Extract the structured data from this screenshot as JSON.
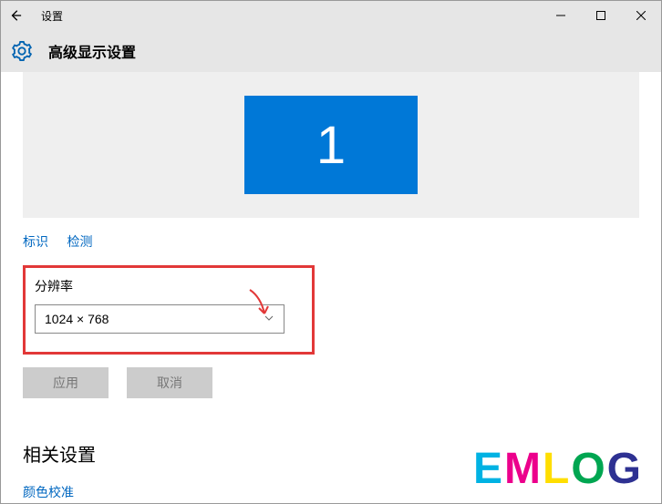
{
  "titlebar": {
    "title": "设置"
  },
  "header": {
    "heading": "高级显示设置"
  },
  "monitor": {
    "number": "1"
  },
  "links": {
    "identify": "标识",
    "detect": "检测"
  },
  "resolution": {
    "label": "分辨率",
    "value": "1024 × 768"
  },
  "actions": {
    "apply": "应用",
    "cancel": "取消"
  },
  "related": {
    "heading": "相关设置",
    "color": "颜色校准"
  },
  "watermark": {
    "w1": "E",
    "w2": "M",
    "w3": "L",
    "w4": "O",
    "w5": "G"
  }
}
